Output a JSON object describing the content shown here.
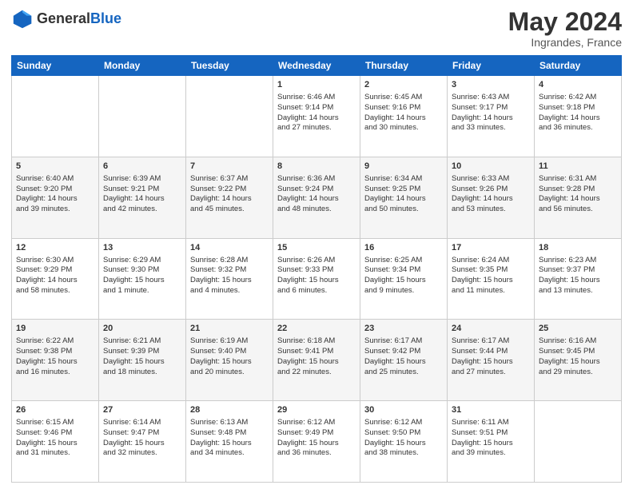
{
  "header": {
    "logo_general": "General",
    "logo_blue": "Blue",
    "month": "May 2024",
    "location": "Ingrandes, France"
  },
  "days_of_week": [
    "Sunday",
    "Monday",
    "Tuesday",
    "Wednesday",
    "Thursday",
    "Friday",
    "Saturday"
  ],
  "weeks": [
    [
      {
        "day": "",
        "info": ""
      },
      {
        "day": "",
        "info": ""
      },
      {
        "day": "",
        "info": ""
      },
      {
        "day": "1",
        "info": "Sunrise: 6:46 AM\nSunset: 9:14 PM\nDaylight: 14 hours\nand 27 minutes."
      },
      {
        "day": "2",
        "info": "Sunrise: 6:45 AM\nSunset: 9:16 PM\nDaylight: 14 hours\nand 30 minutes."
      },
      {
        "day": "3",
        "info": "Sunrise: 6:43 AM\nSunset: 9:17 PM\nDaylight: 14 hours\nand 33 minutes."
      },
      {
        "day": "4",
        "info": "Sunrise: 6:42 AM\nSunset: 9:18 PM\nDaylight: 14 hours\nand 36 minutes."
      }
    ],
    [
      {
        "day": "5",
        "info": "Sunrise: 6:40 AM\nSunset: 9:20 PM\nDaylight: 14 hours\nand 39 minutes."
      },
      {
        "day": "6",
        "info": "Sunrise: 6:39 AM\nSunset: 9:21 PM\nDaylight: 14 hours\nand 42 minutes."
      },
      {
        "day": "7",
        "info": "Sunrise: 6:37 AM\nSunset: 9:22 PM\nDaylight: 14 hours\nand 45 minutes."
      },
      {
        "day": "8",
        "info": "Sunrise: 6:36 AM\nSunset: 9:24 PM\nDaylight: 14 hours\nand 48 minutes."
      },
      {
        "day": "9",
        "info": "Sunrise: 6:34 AM\nSunset: 9:25 PM\nDaylight: 14 hours\nand 50 minutes."
      },
      {
        "day": "10",
        "info": "Sunrise: 6:33 AM\nSunset: 9:26 PM\nDaylight: 14 hours\nand 53 minutes."
      },
      {
        "day": "11",
        "info": "Sunrise: 6:31 AM\nSunset: 9:28 PM\nDaylight: 14 hours\nand 56 minutes."
      }
    ],
    [
      {
        "day": "12",
        "info": "Sunrise: 6:30 AM\nSunset: 9:29 PM\nDaylight: 14 hours\nand 58 minutes."
      },
      {
        "day": "13",
        "info": "Sunrise: 6:29 AM\nSunset: 9:30 PM\nDaylight: 15 hours\nand 1 minute."
      },
      {
        "day": "14",
        "info": "Sunrise: 6:28 AM\nSunset: 9:32 PM\nDaylight: 15 hours\nand 4 minutes."
      },
      {
        "day": "15",
        "info": "Sunrise: 6:26 AM\nSunset: 9:33 PM\nDaylight: 15 hours\nand 6 minutes."
      },
      {
        "day": "16",
        "info": "Sunrise: 6:25 AM\nSunset: 9:34 PM\nDaylight: 15 hours\nand 9 minutes."
      },
      {
        "day": "17",
        "info": "Sunrise: 6:24 AM\nSunset: 9:35 PM\nDaylight: 15 hours\nand 11 minutes."
      },
      {
        "day": "18",
        "info": "Sunrise: 6:23 AM\nSunset: 9:37 PM\nDaylight: 15 hours\nand 13 minutes."
      }
    ],
    [
      {
        "day": "19",
        "info": "Sunrise: 6:22 AM\nSunset: 9:38 PM\nDaylight: 15 hours\nand 16 minutes."
      },
      {
        "day": "20",
        "info": "Sunrise: 6:21 AM\nSunset: 9:39 PM\nDaylight: 15 hours\nand 18 minutes."
      },
      {
        "day": "21",
        "info": "Sunrise: 6:19 AM\nSunset: 9:40 PM\nDaylight: 15 hours\nand 20 minutes."
      },
      {
        "day": "22",
        "info": "Sunrise: 6:18 AM\nSunset: 9:41 PM\nDaylight: 15 hours\nand 22 minutes."
      },
      {
        "day": "23",
        "info": "Sunrise: 6:17 AM\nSunset: 9:42 PM\nDaylight: 15 hours\nand 25 minutes."
      },
      {
        "day": "24",
        "info": "Sunrise: 6:17 AM\nSunset: 9:44 PM\nDaylight: 15 hours\nand 27 minutes."
      },
      {
        "day": "25",
        "info": "Sunrise: 6:16 AM\nSunset: 9:45 PM\nDaylight: 15 hours\nand 29 minutes."
      }
    ],
    [
      {
        "day": "26",
        "info": "Sunrise: 6:15 AM\nSunset: 9:46 PM\nDaylight: 15 hours\nand 31 minutes."
      },
      {
        "day": "27",
        "info": "Sunrise: 6:14 AM\nSunset: 9:47 PM\nDaylight: 15 hours\nand 32 minutes."
      },
      {
        "day": "28",
        "info": "Sunrise: 6:13 AM\nSunset: 9:48 PM\nDaylight: 15 hours\nand 34 minutes."
      },
      {
        "day": "29",
        "info": "Sunrise: 6:12 AM\nSunset: 9:49 PM\nDaylight: 15 hours\nand 36 minutes."
      },
      {
        "day": "30",
        "info": "Sunrise: 6:12 AM\nSunset: 9:50 PM\nDaylight: 15 hours\nand 38 minutes."
      },
      {
        "day": "31",
        "info": "Sunrise: 6:11 AM\nSunset: 9:51 PM\nDaylight: 15 hours\nand 39 minutes."
      },
      {
        "day": "",
        "info": ""
      }
    ]
  ]
}
